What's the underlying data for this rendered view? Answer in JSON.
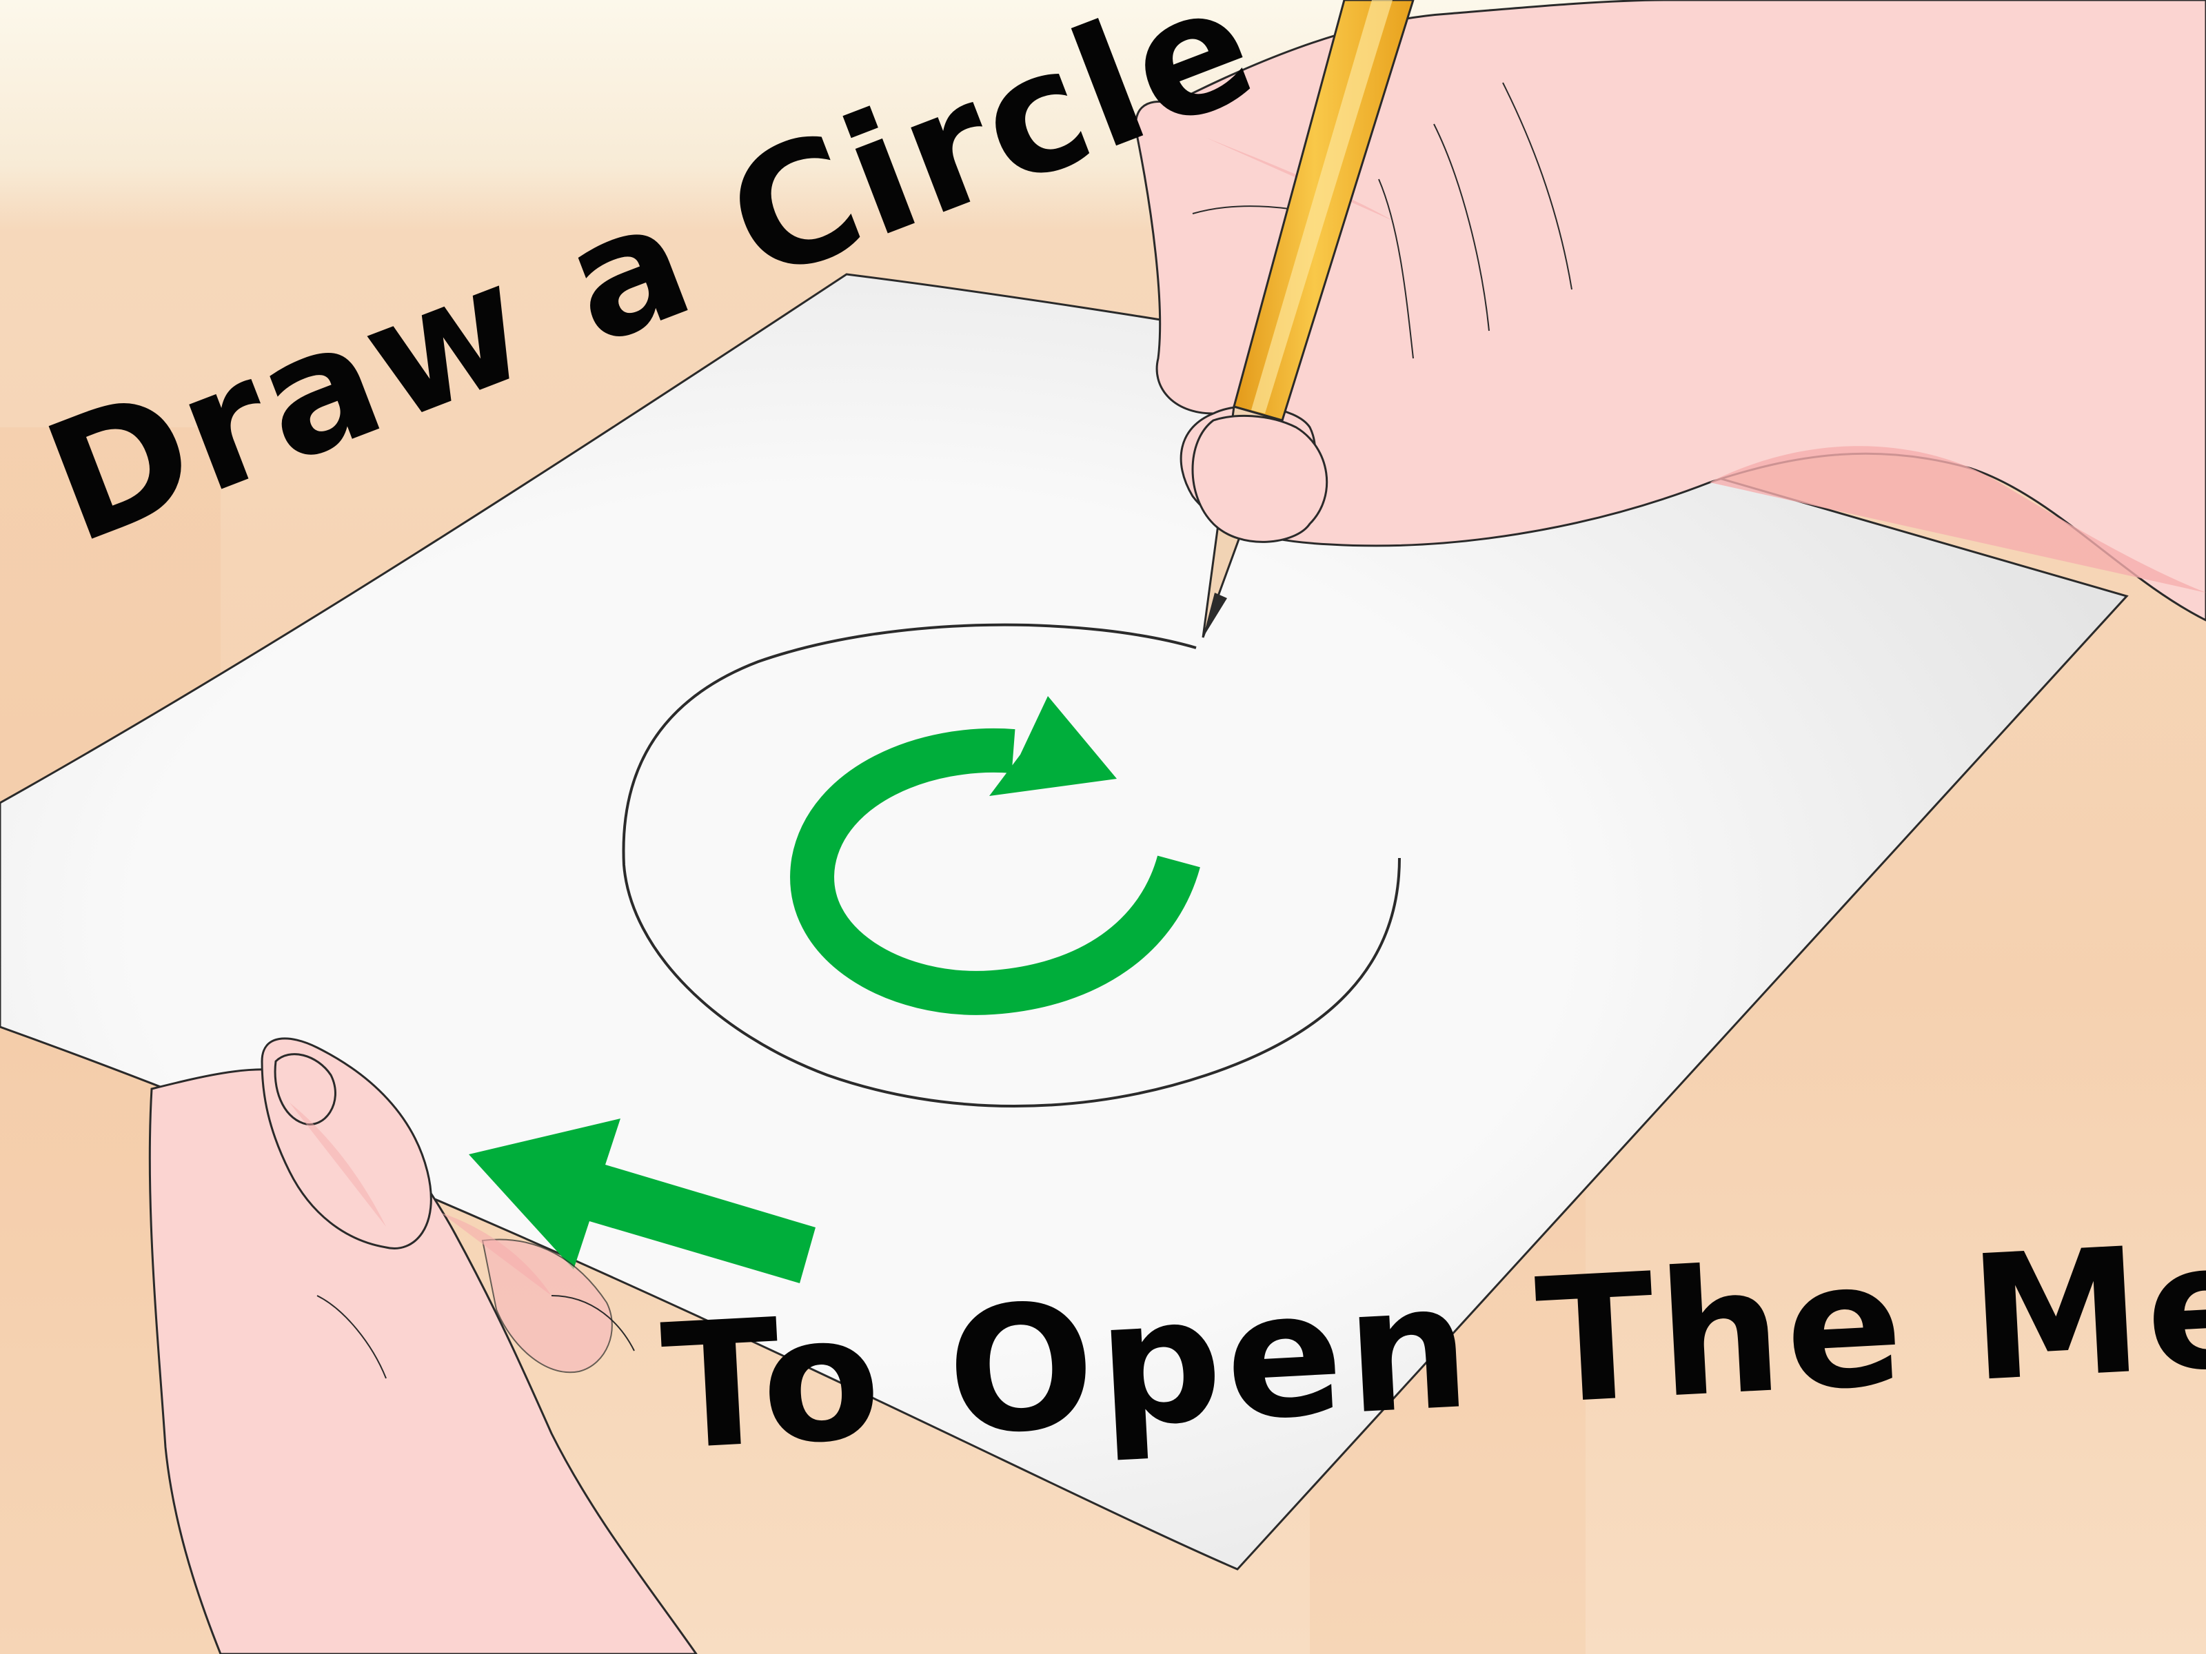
{
  "caption": {
    "line1": "Draw a Circle",
    "line2": "To Open The Menu"
  },
  "colors": {
    "wall": "#fbf5e6",
    "table": "#f6d2b1",
    "paper": "#f8f8f8",
    "skin": "#fbd4d1",
    "skin_shadow": "#f6aeae",
    "pencil": "#f5b62a",
    "pencil_stripe": "#fde59a",
    "arrow_green": "#00ae3b",
    "outline": "#222222",
    "text": "#050505"
  },
  "icons": {
    "rotate": "clockwise-rotate-arrow-icon",
    "direction": "up-left-arrow-icon"
  }
}
